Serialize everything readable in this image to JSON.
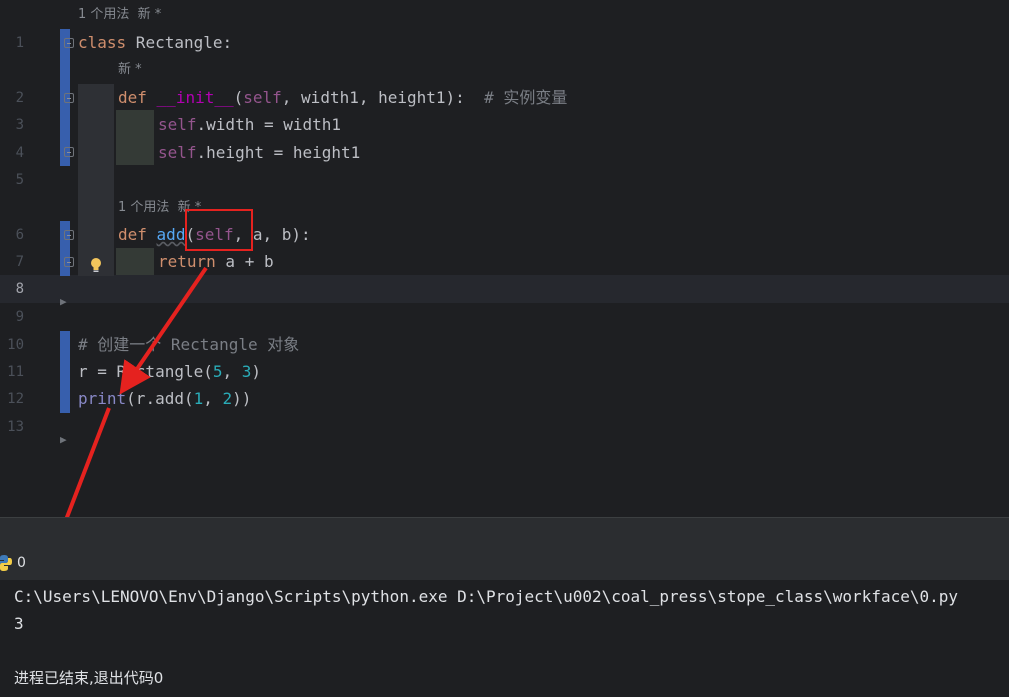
{
  "editor": {
    "line_numbers": [
      "1",
      "2",
      "3",
      "4",
      "5",
      "6",
      "7",
      "8",
      "9",
      "10",
      "11",
      "12",
      "13"
    ],
    "current_line": "8",
    "hints": {
      "class_usage": "1 个用法  新 *",
      "init_new": "新 *",
      "add_usage": "1 个用法  新 *"
    },
    "code": {
      "l1_kw": "class",
      "l1_rest": " Rectangle:",
      "l2_def": "def",
      "l2_space": " ",
      "l2_init": "__init__",
      "l2_paren": "(",
      "l2_self": "self",
      "l2_params": ", width1, height1):",
      "l2_comment": "# 实例变量",
      "l3_self": "self",
      "l3_rest": ".width = width1",
      "l4_self": "self",
      "l4_rest": ".height = height1",
      "l6_def": "def",
      "l6_fn": "add",
      "l6_paren": "(",
      "l6_self": "self",
      "l6_rest": ", a, b):",
      "l7_return": "return",
      "l7_rest": " a + b",
      "l10_comment": "# 创建一个 Rectangle 对象",
      "l11_pre": "r = Rectangle(",
      "l11_n1": "5",
      "l11_comma": ", ",
      "l11_n2": "3",
      "l11_close": ")",
      "l12_print": "print",
      "l12_mid": "(r.add(",
      "l12_n1": "1",
      "l12_comma": ", ",
      "l12_n2": "2",
      "l12_close": "))"
    }
  },
  "run_panel": {
    "tab_label": "0",
    "output": {
      "command": "C:\\Users\\LENOVO\\Env\\Django\\Scripts\\python.exe D:\\Project\\u002\\coal_press\\stope_class\\workface\\0.py",
      "result": "3",
      "exit_message": "进程已结束,退出代码0"
    }
  },
  "colors": {
    "background": "#1e1f22",
    "keyword": "#cf8e6d",
    "self": "#94558d",
    "function": "#56a8f5",
    "number": "#2aacb8",
    "comment": "#7a7e85",
    "vcs_modified": "#375fad",
    "annotation_red": "#e5221f"
  }
}
